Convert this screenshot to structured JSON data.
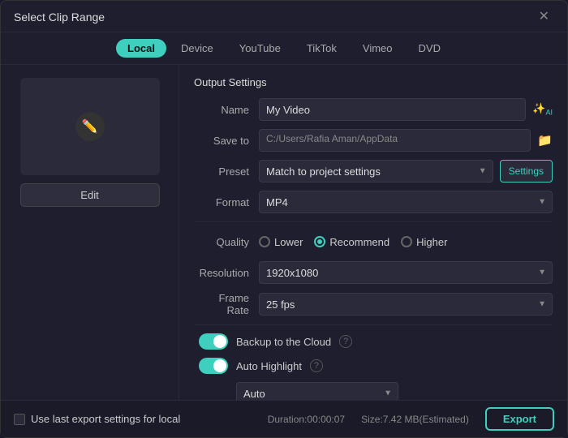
{
  "dialog": {
    "title": "Select Clip Range",
    "close_label": "✕"
  },
  "tabs": [
    {
      "id": "local",
      "label": "Local",
      "active": true
    },
    {
      "id": "device",
      "label": "Device",
      "active": false
    },
    {
      "id": "youtube",
      "label": "YouTube",
      "active": false
    },
    {
      "id": "tiktok",
      "label": "TikTok",
      "active": false
    },
    {
      "id": "vimeo",
      "label": "Vimeo",
      "active": false
    },
    {
      "id": "dvd",
      "label": "DVD",
      "active": false
    }
  ],
  "left_panel": {
    "edit_label": "Edit"
  },
  "output_settings": {
    "section_title": "Output Settings",
    "name_label": "Name",
    "name_value": "My Video",
    "save_to_label": "Save to",
    "save_to_value": "C:/Users/Rafia Aman/AppData",
    "preset_label": "Preset",
    "preset_value": "Match to project settings",
    "settings_label": "Settings",
    "format_label": "Format",
    "format_value": "MP4",
    "quality_label": "Quality",
    "quality_options": [
      {
        "label": "Lower",
        "checked": false
      },
      {
        "label": "Recommend",
        "checked": true
      },
      {
        "label": "Higher",
        "checked": false
      }
    ],
    "resolution_label": "Resolution",
    "resolution_value": "1920x1080",
    "frame_rate_label": "Frame Rate",
    "frame_rate_value": "25 fps",
    "backup_label": "Backup to the Cloud",
    "backup_on": true,
    "auto_highlight_label": "Auto Highlight",
    "auto_highlight_on": true,
    "auto_select_value": "Auto"
  },
  "bottom_bar": {
    "use_last_label": "Use last export settings for local",
    "duration_label": "Duration:00:00:07",
    "size_label": "Size:7.42 MB(Estimated)",
    "export_label": "Export"
  }
}
